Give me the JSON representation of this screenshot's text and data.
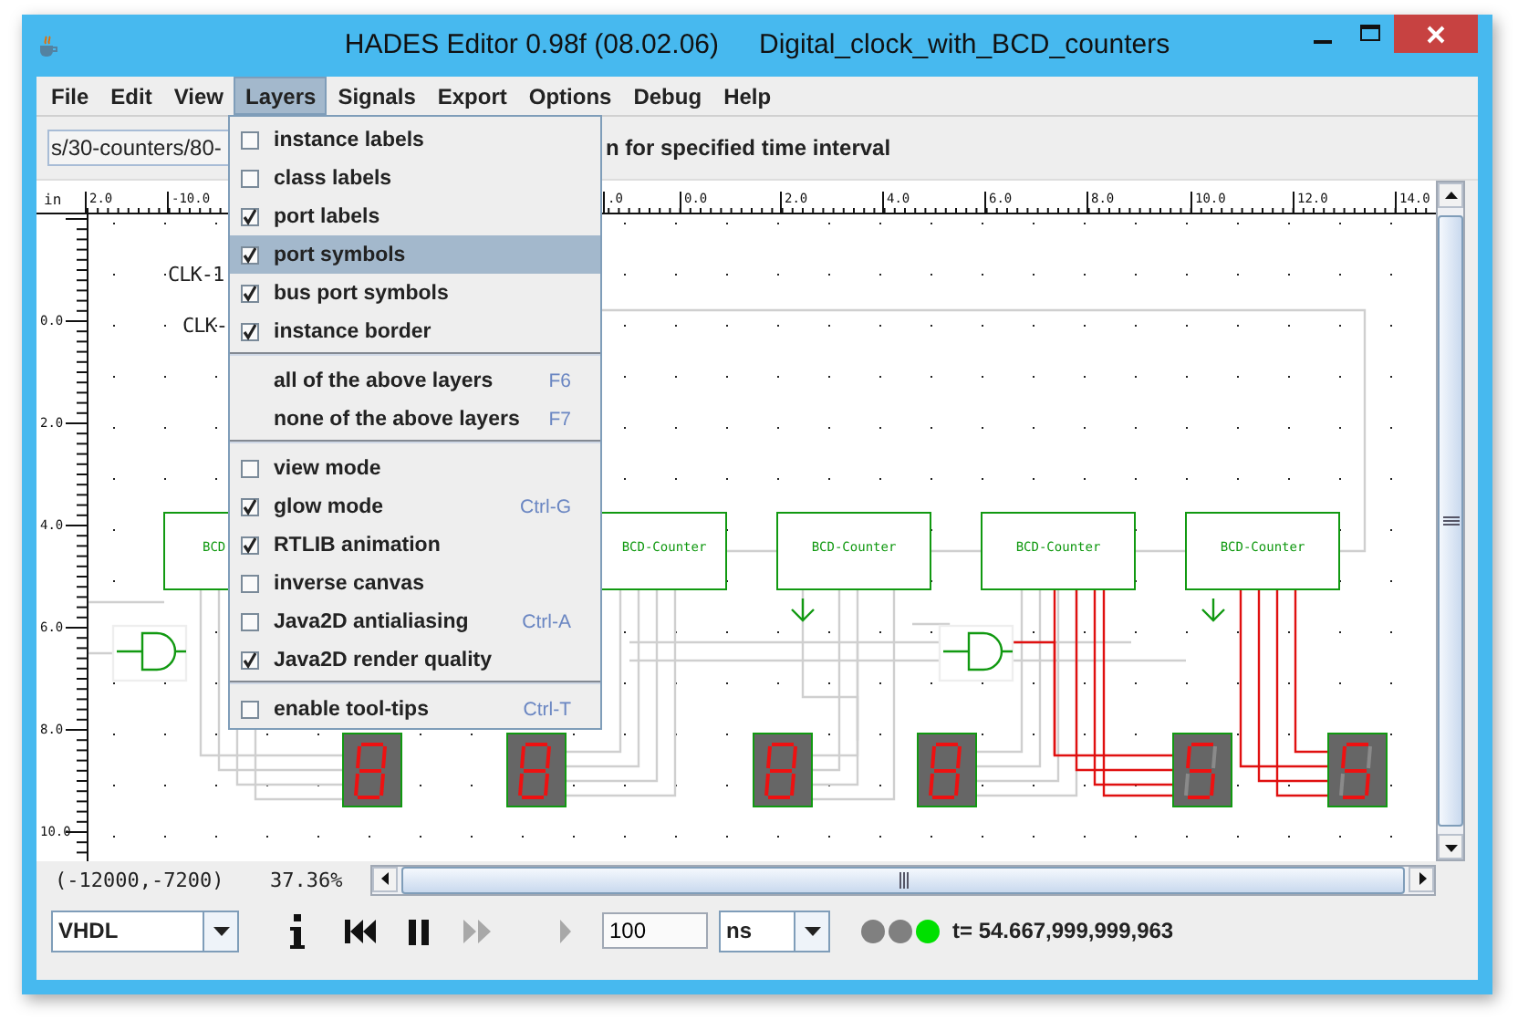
{
  "window": {
    "title": "HADES Editor 0.98f (08.02.06)",
    "document": "Digital_clock_with_BCD_counters"
  },
  "menu_bar": [
    {
      "label": "File",
      "selected": false
    },
    {
      "label": "Edit",
      "selected": false
    },
    {
      "label": "View",
      "selected": false
    },
    {
      "label": "Layers",
      "selected": true
    },
    {
      "label": "Signals",
      "selected": false
    },
    {
      "label": "Export",
      "selected": false
    },
    {
      "label": "Options",
      "selected": false
    },
    {
      "label": "Debug",
      "selected": false
    },
    {
      "label": "Help",
      "selected": false
    }
  ],
  "toolbar": {
    "path_field": {
      "value": "s/30-counters/80-"
    },
    "hint": "n for specified time interval"
  },
  "layers_menu": {
    "items": [
      {
        "kind": "check",
        "label": "instance labels",
        "checked": false,
        "selected": false
      },
      {
        "kind": "check",
        "label": "class labels",
        "checked": false,
        "selected": false
      },
      {
        "kind": "check",
        "label": "port labels",
        "checked": true,
        "selected": false
      },
      {
        "kind": "check",
        "label": "port symbols",
        "checked": true,
        "selected": true
      },
      {
        "kind": "check",
        "label": "bus port symbols",
        "checked": true,
        "selected": false
      },
      {
        "kind": "check",
        "label": "instance border",
        "checked": true,
        "selected": false
      },
      {
        "kind": "separator"
      },
      {
        "kind": "action",
        "label": "all of the above layers",
        "shortcut": "F6",
        "selected": false
      },
      {
        "kind": "action",
        "label": "none of the above layers",
        "shortcut": "F7",
        "selected": false
      },
      {
        "kind": "separator"
      },
      {
        "kind": "check",
        "label": "view mode",
        "checked": false,
        "selected": false
      },
      {
        "kind": "check",
        "label": "glow mode",
        "checked": true,
        "shortcut": "Ctrl-G",
        "selected": false
      },
      {
        "kind": "check",
        "label": "RTLIB animation",
        "checked": true,
        "selected": false
      },
      {
        "kind": "check",
        "label": "inverse canvas",
        "checked": false,
        "selected": false
      },
      {
        "kind": "check",
        "label": "Java2D antialiasing",
        "checked": false,
        "shortcut": "Ctrl-A",
        "selected": false
      },
      {
        "kind": "check",
        "label": "Java2D render quality",
        "checked": true,
        "selected": false
      },
      {
        "kind": "separator"
      },
      {
        "kind": "check",
        "label": "enable tool-tips",
        "checked": false,
        "shortcut": "Ctrl-T",
        "selected": false
      }
    ]
  },
  "canvas": {
    "unit": "in",
    "top_ruler": [
      "2.0",
      "-10.0",
      ".0",
      "0.0",
      "2.0",
      "4.0",
      "6.0",
      "8.0",
      "10.0",
      "12.0",
      "14.0"
    ],
    "left_ruler": [
      "0.0",
      "2.0",
      "4.0",
      "6.0",
      "8.0",
      "10.0"
    ],
    "labels": [
      "CLK-1",
      "CLK-"
    ],
    "counters": [
      {
        "label": "BCD"
      },
      {
        "label": "BCD-Counter"
      },
      {
        "label": "BCD-Counter"
      },
      {
        "label": "BCD-Counter"
      },
      {
        "label": "BCD-Counter"
      }
    ]
  },
  "status": {
    "coordinates": "(-12000,-7200)",
    "zoom": "37.36%"
  },
  "sim_bar": {
    "mode_combo": {
      "value": "VHDL"
    },
    "buttons": [
      {
        "kind": "info",
        "disabled": false
      },
      {
        "kind": "rewind",
        "disabled": false
      },
      {
        "kind": "pause",
        "disabled": false
      },
      {
        "kind": "fast-forward",
        "disabled": true
      },
      {
        "kind": "play",
        "disabled": true
      }
    ],
    "step_field": {
      "value": "100"
    },
    "unit_combo": {
      "value": "ns"
    },
    "leds": [
      {
        "color": "#808080"
      },
      {
        "color": "#808080"
      },
      {
        "color": "#00e000"
      }
    ],
    "time": "t= 54.667,999,999,963"
  }
}
